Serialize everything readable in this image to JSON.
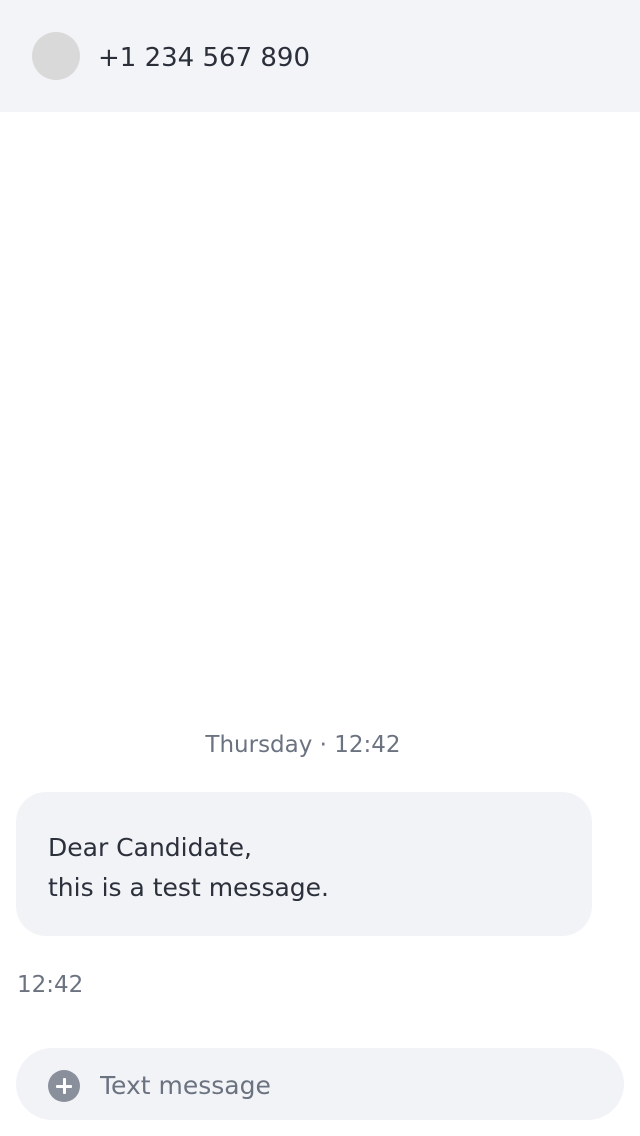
{
  "header": {
    "contact_number": "+1 234 567 890"
  },
  "conversation": {
    "date_separator": "Thursday · 12:42",
    "messages": [
      {
        "lines": [
          "Dear Candidate,",
          "this is a test message."
        ],
        "time": "12:42"
      }
    ]
  },
  "composer": {
    "placeholder": "Text message",
    "value": "",
    "attach_icon": "plus-circle-icon"
  }
}
